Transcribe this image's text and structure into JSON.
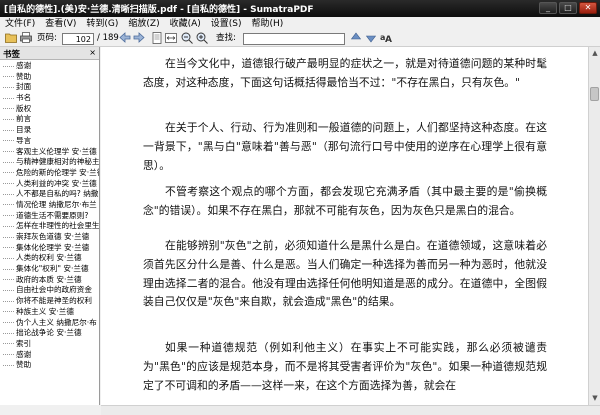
{
  "window": {
    "title": "[自私的德性].(美)安·兰德.清晰扫描版.pdf - [自私的德性] - SumatraPDF",
    "minimize": "_",
    "maximize": "□",
    "close": "✕"
  },
  "menu": [
    "文件(F)",
    "查看(V)",
    "转到(G)",
    "缩放(Z)",
    "收藏(A)",
    "设置(S)",
    "帮助(H)"
  ],
  "toolbar": {
    "page_label": "页码:",
    "page_value": "102",
    "page_total": "/ 189",
    "find_label": "查找:",
    "find_value": "",
    "icons": [
      "open-icon",
      "print-icon",
      "prev-page-icon",
      "next-page-icon",
      "fit-page-icon",
      "fit-width-icon",
      "zoom-out-icon",
      "zoom-in-icon",
      "find-prev-icon",
      "find-next-icon",
      "match-case-icon"
    ]
  },
  "sidebar": {
    "title": "书签",
    "close": "×",
    "items": [
      "感谢",
      "赞助",
      "封面",
      "书名",
      "版权",
      "前言",
      "目录",
      "导言",
      "客观主义伦理学 安·兰德",
      "与精神健康相对的神秘主义",
      "危险的斯的伦理学 安·兰德",
      "人类利益的冲突 安·兰德",
      "人不都是自私的吗? 纳撒",
      "情况伦理 纳撒尼尔·布兰",
      "道德生活不需要原则?",
      "怎样在非理性的社会里生",
      "崇拜灰色道德 安·兰德",
      "集体化伦理学 安·兰德",
      "人类的权利 安·兰德",
      "集体化\"权利\" 安·兰德",
      "政府的本质 安·兰德",
      "自由社会中的政府资金",
      "你将不能是神圣的权利",
      "种族主义 安·兰德",
      "伪个人主义 纳撒尼尔·布",
      "拙论战争论 安·兰德",
      "索引",
      "感谢",
      "赞助"
    ]
  },
  "document": {
    "paragraphs": [
      "在当今文化中，道德银行破产最明显的症状之一，就是对待道德问题的某种时髦态度，对这种态度，下面这句话概括得最恰当不过：\"不存在黑白，只有灰色。\"",
      "在关于个人、行动、行为准则和一般道德的问题上，人们都坚持这种态度。在这一背景下，\"黑与白\"意味着\"善与恶\"（那句流行口号中使用的逆序在心理学上很有意思）。",
      "不管考察这个观点的哪个方面，都会发现它充满矛盾（其中最主要的是\"偷换概念\"的错误）。如果不存在黑白，那就不可能有灰色，因为灰色只是黑白的混合。",
      "在能够辨别\"灰色\"之前，必须知道什么是黑什么是白。在道德领域，这意味着必须首先区分什么是善、什么是恶。当人们确定一种选择为善而另一种为恶时，他就没理由选择二者的混合。他没有理由选择任何他明知道是恶的成分。在道德中，全图假装自己仅仅是\"灰色\"来自欺，就会造成\"黑色\"的结果。",
      "如果一种道德规范（例如利他主义）在事实上不可能实践，那么必须被谴责为\"黑色\"的应该是规范本身，而不是将其受害者评价为\"灰色\"。如果一种道德规范规定了不可调和的矛盾——这样一来，在这个方面选择为善，就会在"
    ]
  },
  "colors": {
    "titlebar": "#1a1a1a",
    "close_button": "#c0392b",
    "page_background": "#ffffff"
  }
}
